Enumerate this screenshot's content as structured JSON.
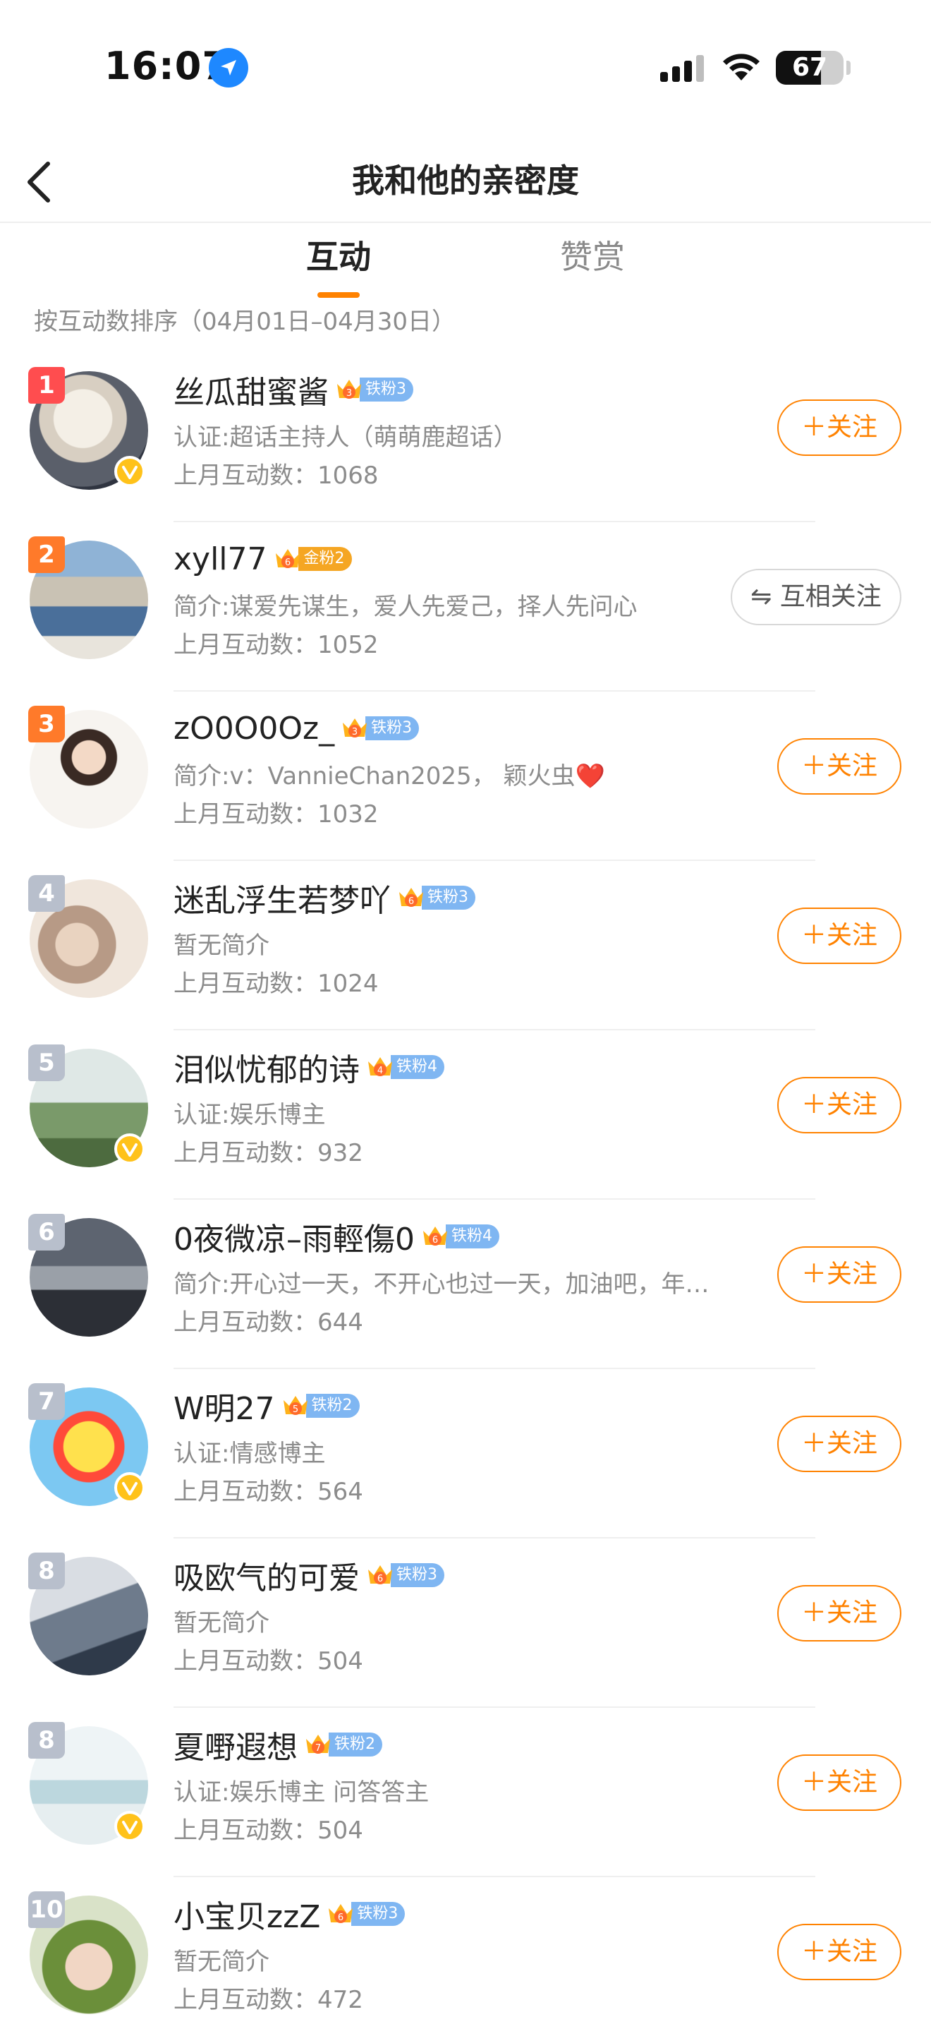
{
  "status_bar": {
    "time": "16:07",
    "battery": "67",
    "battery_level": 0.67,
    "icons": [
      "location-arrow-icon",
      "cellular-signal-icon",
      "wifi-icon",
      "battery-icon"
    ]
  },
  "nav": {
    "title": "我和他的亲密度",
    "back_icon": "chevron-left-icon"
  },
  "tabs": [
    {
      "label": "互动",
      "active": true
    },
    {
      "label": "赞赏",
      "active": false
    }
  ],
  "sort_caption": "按互动数排序（04月01日–04月30日）",
  "colors": {
    "accent": "#ff8200",
    "iron_fan": "#7fb6f2",
    "gold_fan": "#f5a623",
    "verified": "#ffc21a",
    "rank_top": "#ff5a3c",
    "rank_other": "#b8bfcc"
  },
  "users": [
    {
      "rank": "1",
      "name": "丝瓜甜蜜酱",
      "fan_level": "3",
      "fan_label": "铁粉3",
      "fan_kind": "iron",
      "intro": "认证:超话主持人（萌萌鹿超话）",
      "count": "上月互动数：1068",
      "verified": true,
      "action": "＋关注"
    },
    {
      "rank": "2",
      "name": "xyll77",
      "fan_level": "6",
      "fan_label": "金粉2",
      "fan_kind": "gold",
      "intro": "简介:谋爱先谋生，爱人先爱己，择人先问心",
      "count": "上月互动数：1052",
      "verified": false,
      "action": "⇋ 互相关注"
    },
    {
      "rank": "3",
      "name": "zO0O0Oz_",
      "fan_level": "3",
      "fan_label": "铁粉3",
      "fan_kind": "iron",
      "intro": "简介:v：VannieChan2025，  颖火虫❤️",
      "count": "上月互动数：1032",
      "verified": false,
      "action": "＋关注"
    },
    {
      "rank": "4",
      "name": "迷乱浮生若梦吖",
      "fan_level": "6",
      "fan_label": "铁粉3",
      "fan_kind": "iron",
      "intro": "暂无简介",
      "count": "上月互动数：1024",
      "verified": false,
      "action": "＋关注"
    },
    {
      "rank": "5",
      "name": "泪似忧郁的诗",
      "fan_level": "4",
      "fan_label": "铁粉4",
      "fan_kind": "iron",
      "intro": "认证:娱乐博主",
      "count": "上月互动数：932",
      "verified": true,
      "action": "＋关注"
    },
    {
      "rank": "6",
      "name": "0夜微凉–雨輕傷0",
      "fan_level": "6",
      "fan_label": "铁粉4",
      "fan_kind": "iron",
      "intro": "简介:开心过一天，不开心也过一天，加油吧，年…",
      "count": "上月互动数：644",
      "verified": false,
      "action": "＋关注"
    },
    {
      "rank": "7",
      "name": "W明27",
      "fan_level": "5",
      "fan_label": "铁粉2",
      "fan_kind": "iron",
      "intro": "认证:情感博主",
      "count": "上月互动数：564",
      "verified": true,
      "action": "＋关注"
    },
    {
      "rank": "8",
      "name": "吸欧气的可爱",
      "fan_level": "6",
      "fan_label": "铁粉3",
      "fan_kind": "iron",
      "intro": "暂无简介",
      "count": "上月互动数：504",
      "verified": false,
      "action": "＋关注"
    },
    {
      "rank": "8",
      "name": "夏嘢遐想",
      "fan_level": "7",
      "fan_label": "铁粉2",
      "fan_kind": "iron",
      "intro": "认证:娱乐博主 问答答主",
      "count": "上月互动数：504",
      "verified": true,
      "action": "＋关注"
    },
    {
      "rank": "10",
      "name": "小宝贝zzZ",
      "fan_level": "6",
      "fan_label": "铁粉3",
      "fan_kind": "iron",
      "intro": "暂无简介",
      "count": "上月互动数：472",
      "verified": false,
      "action": "＋关注"
    }
  ]
}
